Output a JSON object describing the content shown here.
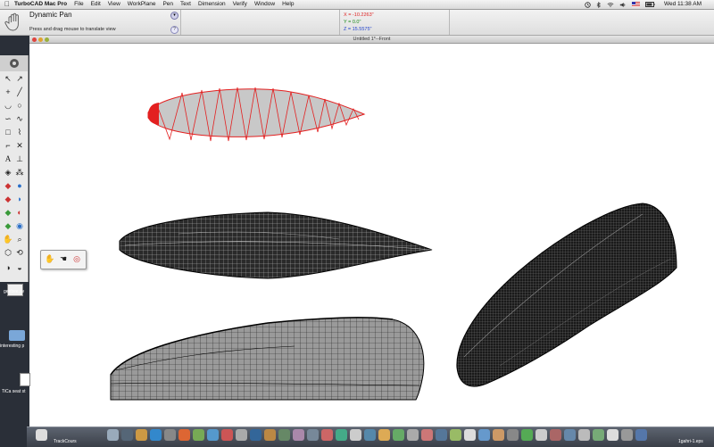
{
  "menubar": {
    "apple": "",
    "app_name": "TurboCAD Mac Pro",
    "items": [
      "File",
      "Edit",
      "View",
      "WorkPlane",
      "Pen",
      "Text",
      "Dimension",
      "Verify",
      "Window",
      "Help"
    ],
    "clock": "Wed 11:38 AM"
  },
  "inspector": {
    "tool_name": "Dynamic Pan",
    "hint": "Press and drag mouse to translate view",
    "help": "?",
    "coords": {
      "x": "X = -10.2263\"",
      "y": "Y = 0.0\"",
      "z": "Z = 15.5575\""
    }
  },
  "document": {
    "title": "Untitled 1*--Front"
  },
  "desktop": {
    "icons": [
      "geebee.sv",
      "interesting p",
      "TiCa seat st"
    ]
  },
  "dock": {
    "label_left": "TrackCours",
    "label_right": "1gahri-1.eps"
  },
  "colors": {
    "wire_red": "#e32020",
    "fill_gray": "#c8c8c8",
    "mesh_dark": "#111111"
  }
}
